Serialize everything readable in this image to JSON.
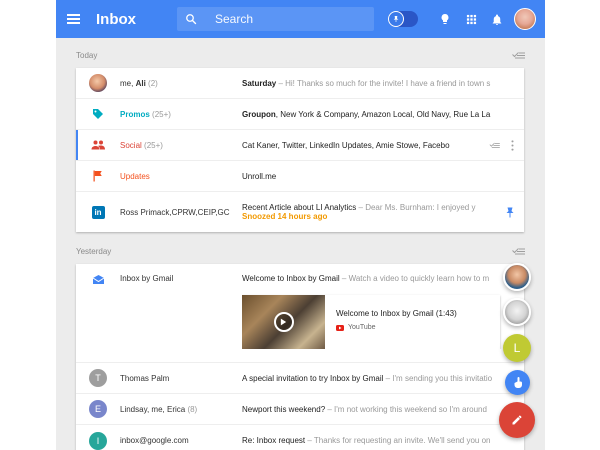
{
  "header": {
    "title": "Inbox",
    "search_placeholder": "Search",
    "accent": "#4285f4"
  },
  "today": {
    "label": "Today",
    "rows": [
      {
        "sender_name": "me, ",
        "sender_bold": "Ali",
        "count": "(2)",
        "subject": "Saturday",
        "snippet": " – Hi! Thanks so much for the invite! I have a friend in town s"
      },
      {
        "sender": "Promos",
        "count": "(25+)",
        "subject": "Groupon",
        "snippet": ", New York & Company, Amazon Local, Old Navy, Rue La La",
        "color": "#00acc1"
      },
      {
        "sender": "Social",
        "count": "(25+)",
        "subject": "",
        "snippet": "Cat Kaner, Twitter, LinkedIn Updates, Amie Stowe, Facebo",
        "color": "#db4437"
      },
      {
        "sender": "Updates",
        "count": "",
        "subject": "",
        "snippet": "Unroll.me",
        "color": "#f4511e"
      },
      {
        "sender": "Ross Primack,CPRW,CEIP,GC",
        "subject": "Recent Article about LI Analytics",
        "snippet": " – Dear Ms. Burnham: I enjoyed y",
        "snoozed": "Snoozed 14 hours ago"
      }
    ]
  },
  "yesterday": {
    "label": "Yesterday",
    "rows": [
      {
        "sender": "Inbox by Gmail",
        "subject": "Welcome to Inbox by Gmail",
        "snippet": " – Watch a video to quickly learn how to m",
        "attachment_title": "Welcome to Inbox by Gmail (1:43)",
        "attachment_source": "YouTube"
      },
      {
        "sender": "Thomas Palm",
        "initial": "T",
        "subject": "A special invitation to try Inbox by Gmail",
        "snippet": " – I'm sending you this invitatio",
        "color": "#9e9e9e"
      },
      {
        "sender_name": "Lindsay, me, Erica ",
        "count": "(8)",
        "initial": "E",
        "subject": "Newport this weekend?",
        "snippet": " – I'm not working this weekend so I'm around",
        "color": "#7986cb"
      },
      {
        "sender": "inbox@google.com",
        "initial": "I",
        "subject": "Re: Inbox request",
        "snippet": " – Thanks for requesting an invite. We'll send you on",
        "color": "#26a69a"
      }
    ]
  },
  "fabs": {
    "contact_initial": "L",
    "compose_color": "#db4437",
    "reminder_color": "#4285f4",
    "contact_color": "#c0ca33"
  }
}
